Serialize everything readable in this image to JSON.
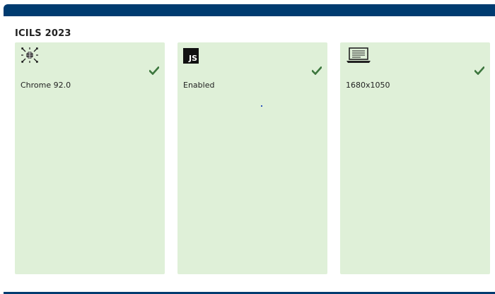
{
  "app": {
    "title": "ICILS 2023"
  },
  "cards": [
    {
      "icon": "browser-globe-icon",
      "value": "Chrome 92.0",
      "status": "ok"
    },
    {
      "icon": "javascript-icon",
      "badge": "JS",
      "value": "Enabled",
      "status": "ok"
    },
    {
      "icon": "laptop-icon",
      "value": "1680x1050",
      "status": "ok"
    }
  ],
  "colors": {
    "header": "#003b70",
    "card_bg": "#dff0d8",
    "check": "#3c763d"
  }
}
